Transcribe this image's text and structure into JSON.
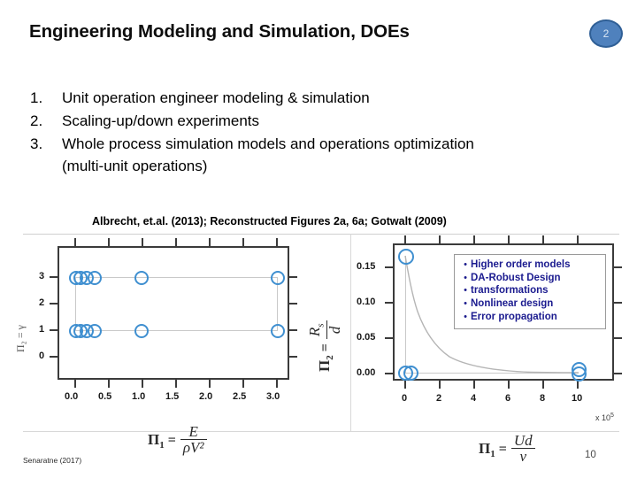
{
  "slide": {
    "title": "Engineering Modeling and Simulation, DOEs",
    "badge_number": "2",
    "page_number": "10",
    "source_note": "Senaratne (2017)",
    "citation": "Albrecht, et.al. (2013); Reconstructed Figures 2a, 6a; Gotwalt (2009)",
    "accent_color": "#4f81bd",
    "marker_color": "#3f8fd0",
    "callout_text_color": "#1b1b8f"
  },
  "list": {
    "items": [
      {
        "number": "1.",
        "text": "Unit operation engineer modeling & simulation"
      },
      {
        "number": "2.",
        "text": "Scaling-up/down experiments"
      },
      {
        "number": "3.",
        "text": "Whole process simulation models and operations optimization (multi-unit operations)"
      }
    ]
  },
  "callout": {
    "bullet_glyph": "•",
    "items": [
      "Higher order models",
      "DA-Robust Design",
      "transformations",
      "Nonlinear design",
      "Error propagation"
    ]
  },
  "formulas": {
    "left_x": {
      "pi": "Π",
      "sub": "1",
      "eq": "=",
      "numerator": "E",
      "denominator": "ρV²"
    },
    "left_y": {
      "pi": "Π",
      "sub": "2",
      "eq": "=",
      "numerator": "R",
      "numerator_sub": "s",
      "denominator": "d"
    },
    "right_x": {
      "pi": "Π",
      "sub": "1",
      "eq": "=",
      "numerator": "Ud",
      "denominator": "ν"
    },
    "left_y_axis_short": "Π₂ = γ"
  },
  "axis_annotations": {
    "right_x_multiplier_prefix": "x 10",
    "right_x_multiplier_exponent": "5"
  },
  "chart_data": [
    {
      "type": "scatter",
      "id": "left-doe-plot",
      "title": "",
      "xlabel": "Π₁ = E / ρV²",
      "ylabel": "Π₂ = Rs / d",
      "xlim": [
        -0.25,
        3.3
      ],
      "ylim": [
        -0.35,
        3.75
      ],
      "xticks": [
        0.0,
        0.5,
        1.0,
        1.5,
        2.0,
        2.5,
        3.0
      ],
      "xticklabels": [
        "0.0",
        "0.5",
        "1.0",
        "1.5",
        "2.0",
        "2.5",
        "3.0"
      ],
      "yticks": [
        0,
        1,
        2,
        3
      ],
      "yticklabels": [
        "0",
        "1",
        "2",
        "3"
      ],
      "grid": true,
      "legend": "none",
      "points": [
        {
          "x": 0.0,
          "y": 3
        },
        {
          "x": 0.06,
          "y": 3
        },
        {
          "x": 0.14,
          "y": 3
        },
        {
          "x": 0.27,
          "y": 3
        },
        {
          "x": 1.0,
          "y": 3
        },
        {
          "x": 3.0,
          "y": 3
        },
        {
          "x": 0.0,
          "y": 1
        },
        {
          "x": 0.06,
          "y": 1
        },
        {
          "x": 0.14,
          "y": 1
        },
        {
          "x": 0.27,
          "y": 1
        },
        {
          "x": 1.0,
          "y": 1
        },
        {
          "x": 3.0,
          "y": 1
        }
      ]
    },
    {
      "type": "line",
      "id": "right-decay-plot",
      "title": "",
      "xlabel": "Π₁ = Ud / ν",
      "ylabel": "",
      "xlim": [
        -0.6,
        11.5
      ],
      "ylim": [
        -0.012,
        0.185
      ],
      "xticks": [
        0,
        2,
        4,
        6,
        8,
        10
      ],
      "xticklabels": [
        "0",
        "2",
        "4",
        "6",
        "8",
        "10"
      ],
      "yticks": [
        0.0,
        0.05,
        0.1,
        0.15
      ],
      "yticklabels": [
        "0.00",
        "0.05",
        "0.10",
        "0.15"
      ],
      "x_multiplier": "x 10^5",
      "grid": true,
      "legend": "none",
      "curve": {
        "name": "decay",
        "x": [
          0.05,
          0.3,
          0.7,
          1.2,
          1.8,
          2.5,
          3.2,
          4.0,
          5.0,
          6.0,
          7.0,
          8.0,
          9.0,
          10.0
        ],
        "y": [
          0.163,
          0.128,
          0.094,
          0.068,
          0.049,
          0.034,
          0.025,
          0.018,
          0.012,
          0.009,
          0.007,
          0.006,
          0.005,
          0.004
        ]
      },
      "points": [
        {
          "x": 0.05,
          "y": 0.163
        },
        {
          "x": 0.05,
          "y": 0.0
        },
        {
          "x": 0.4,
          "y": 0.0
        },
        {
          "x": 10.0,
          "y": 0.0
        },
        {
          "x": 10.0,
          "y": 0.004
        }
      ]
    }
  ]
}
